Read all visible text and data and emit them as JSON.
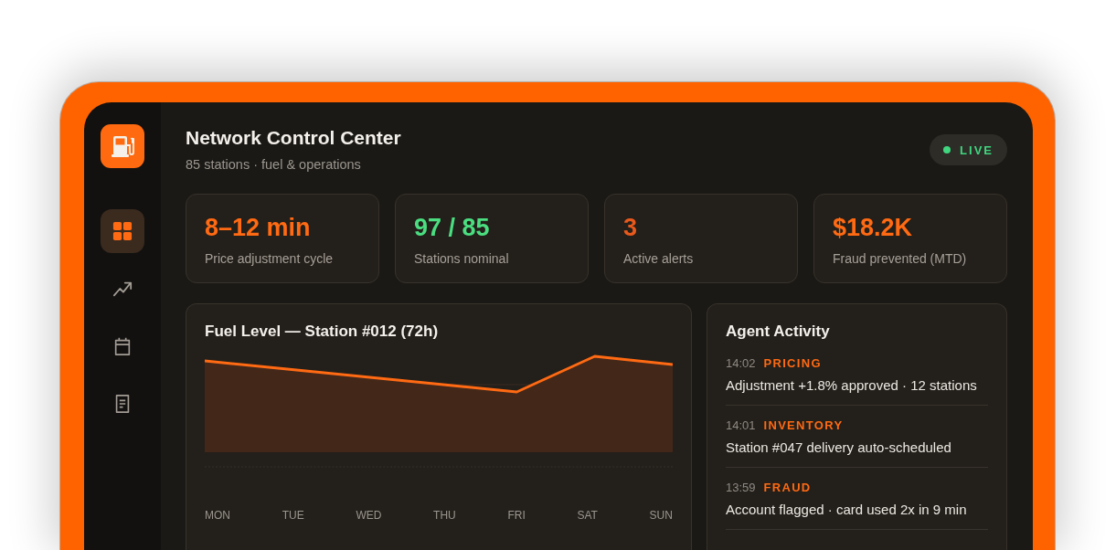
{
  "sidebar": {
    "nav": [
      {
        "selected": true
      },
      {
        "selected": false
      },
      {
        "selected": false
      },
      {
        "selected": false
      }
    ]
  },
  "header": {
    "title": "Network Control Center",
    "subtitle": "85 stations · fuel & operations",
    "status": "LIVE"
  },
  "stats": [
    {
      "value": "8–12 min",
      "label": "Price adjustment cycle",
      "color": "#ff6a13"
    },
    {
      "value": "97 / 85",
      "label": "Stations nominal",
      "color": "#4ade80"
    },
    {
      "value": "3",
      "label": "Active alerts",
      "color": "#e8591c"
    },
    {
      "value": "$18.2K",
      "label": "Fraud prevented (MTD)",
      "color": "#ff6a13"
    }
  ],
  "chart": {
    "title": "Fuel Level — Station #012 (72h)",
    "x_labels": [
      "MON",
      "TUE",
      "WED",
      "THU",
      "FRI",
      "SAT",
      "SUN"
    ]
  },
  "activity": {
    "title": "Agent Activity",
    "items": [
      {
        "time": "14:02",
        "category": "PRICING",
        "text": "Adjustment +1.8% approved · 12 stations"
      },
      {
        "time": "14:01",
        "category": "INVENTORY",
        "text": "Station #047 delivery auto-scheduled"
      },
      {
        "time": "13:59",
        "category": "FRAUD",
        "text": "Account flagged · card used 2x in 9 min"
      }
    ]
  }
}
